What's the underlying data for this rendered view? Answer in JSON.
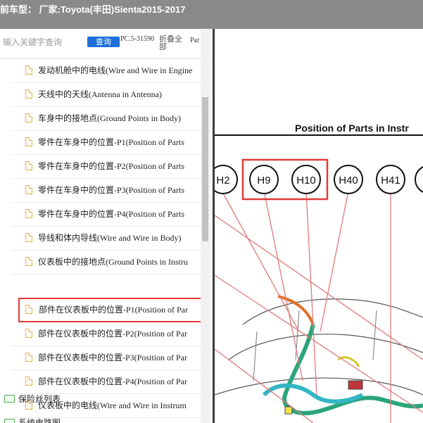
{
  "window": {
    "title": "前车型： 厂家:Toyota(丰田)Sienta2015-2017"
  },
  "search": {
    "placeholder": "输入关键字查询",
    "button_label": "查询",
    "pc_code": "PC.5-31590",
    "collapse_label": "折叠全部",
    "doc_tab": "Par"
  },
  "tree": {
    "items": [
      {
        "label": "发动机舱中的电线(Wire and Wire in Engine"
      },
      {
        "label": "天线中的天线(Antenna in Antenna)"
      },
      {
        "label": "车身中的接地点(Ground Points in Body)"
      },
      {
        "label": "零件在车身中的位置-P1(Position of Parts"
      },
      {
        "label": "零件在车身中的位置-P2(Position of Parts"
      },
      {
        "label": "零件在车身中的位置-P3(Position of Parts"
      },
      {
        "label": "零件在车身中的位置-P4(Position of Parts"
      },
      {
        "label": "导线和体内导线(Wire and Wire in Body)"
      },
      {
        "label": "仪表板中的接地点(Ground Points in Instru"
      },
      {
        "label": "部件在仪表板中的位置-P1(Position of Par",
        "selected": true
      },
      {
        "label": "部件在仪表板中的位置-P2(Position of Par"
      },
      {
        "label": "部件在仪表板中的位置-P3(Position of Par"
      },
      {
        "label": "部件在仪表板中的位置-P4(Position of Par"
      },
      {
        "label": "仪表板中的电线(Wire and Wire in Instrum"
      }
    ],
    "folders": [
      {
        "label": "保险丝列表"
      },
      {
        "label": "系统电路图"
      }
    ]
  },
  "document": {
    "heading": "Position of Parts in Instr",
    "connectors": [
      "H2",
      "H9",
      "H10",
      "H40",
      "H41"
    ],
    "highlight_color": "#e03a3a"
  }
}
